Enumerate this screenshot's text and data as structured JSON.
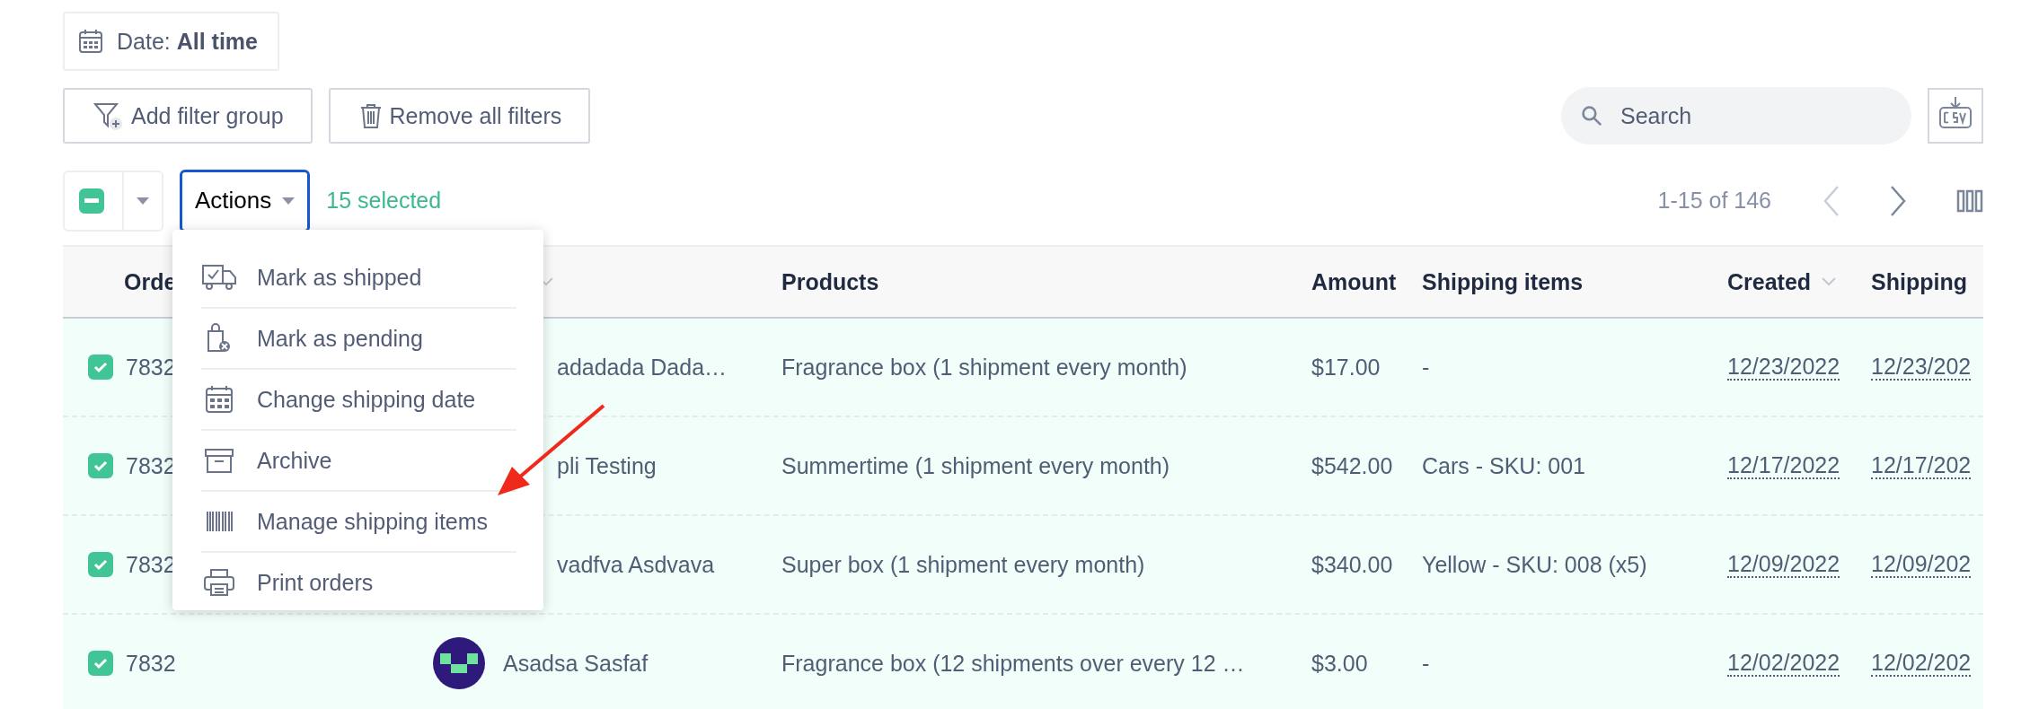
{
  "date_filter": {
    "label": "Date: **All time**"
  },
  "filter_buttons": [
    {
      "kind": "add",
      "label": "Add filter group"
    },
    {
      "kind": "remove",
      "label": "Remove all filters"
    }
  ],
  "search": {
    "placeholder": "Search"
  },
  "bulk": {
    "partial_selection": true,
    "actions_label": "Actions",
    "actions_open": true,
    "selected_count": "15 selected"
  },
  "pagination": {
    "range": "1-15 of 146",
    "prev_disabled": true,
    "next_disabled": false
  },
  "actions_menu": [
    {
      "label": "Mark as shipped"
    },
    {
      "label": "Mark as pending"
    },
    {
      "label": "Change shipping date"
    },
    {
      "label": "Archive"
    },
    {
      "label": "Manage shipping items"
    },
    {
      "label": "Print orders"
    }
  ],
  "table": {
    "columns": [
      {
        "label": "Orde",
        "sortable": false
      },
      {
        "sortable": true
      },
      {
        "label": "Products",
        "sortable": false
      },
      {
        "label": "Amount",
        "sortable": false
      },
      {
        "label": "Shipping items",
        "sortable": false
      },
      {
        "label": "Created",
        "sortable": true
      },
      {
        "label": "Shipping",
        "sortable": false
      }
    ],
    "rows": [
      {
        "checked": true,
        "order": "7832",
        "customer": "adadada Dada…",
        "products": "Fragrance box (1 shipment every month)",
        "amount": "$17.00",
        "shipping_items": "-",
        "created": "12/23/2022",
        "shipping_date": "12/23/202"
      },
      {
        "checked": true,
        "order": "7832",
        "customer": "pli Testing",
        "products": "Summertime (1 shipment every month)",
        "amount": "$542.00",
        "shipping_items": "Cars - SKU: 001",
        "created": "12/17/2022",
        "shipping_date": "12/17/202"
      },
      {
        "checked": true,
        "order": "7832",
        "customer": "vadfva Asdvava",
        "products": "Super box (1 shipment every month)",
        "amount": "$340.00",
        "shipping_items": "Yellow - SKU: 008 (x5)",
        "created": "12/09/2022",
        "shipping_date": "12/09/202"
      },
      {
        "checked": true,
        "order": "7832",
        "avatar": true,
        "customer": "Asadsa Sasfaf",
        "products": "Fragrance box (12 shipments over every 12 …",
        "amount": "$3.00",
        "shipping_items": "-",
        "created": "12/02/2022",
        "shipping_date": "12/02/202"
      }
    ]
  }
}
